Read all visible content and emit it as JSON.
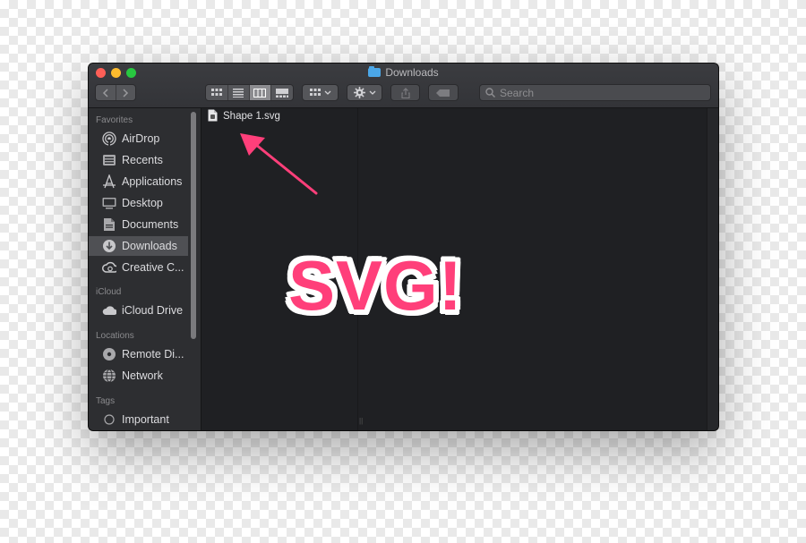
{
  "window": {
    "title": "Downloads"
  },
  "toolbar": {
    "search_placeholder": "Search"
  },
  "sidebar": {
    "sections": {
      "favorites": "Favorites",
      "icloud": "iCloud",
      "locations": "Locations",
      "tags": "Tags"
    },
    "items": {
      "airdrop": "AirDrop",
      "recents": "Recents",
      "applications": "Applications",
      "desktop": "Desktop",
      "documents": "Documents",
      "downloads": "Downloads",
      "creative": "Creative C...",
      "icloud_drive": "iCloud Drive",
      "remote_disc": "Remote Di...",
      "network": "Network",
      "important": "Important"
    },
    "selected": "Downloads"
  },
  "files": [
    {
      "name": "Shape 1.svg",
      "icon": "svg-file-icon"
    }
  ],
  "annotation": {
    "text": "SVG!",
    "color": "#ff3f7a"
  }
}
